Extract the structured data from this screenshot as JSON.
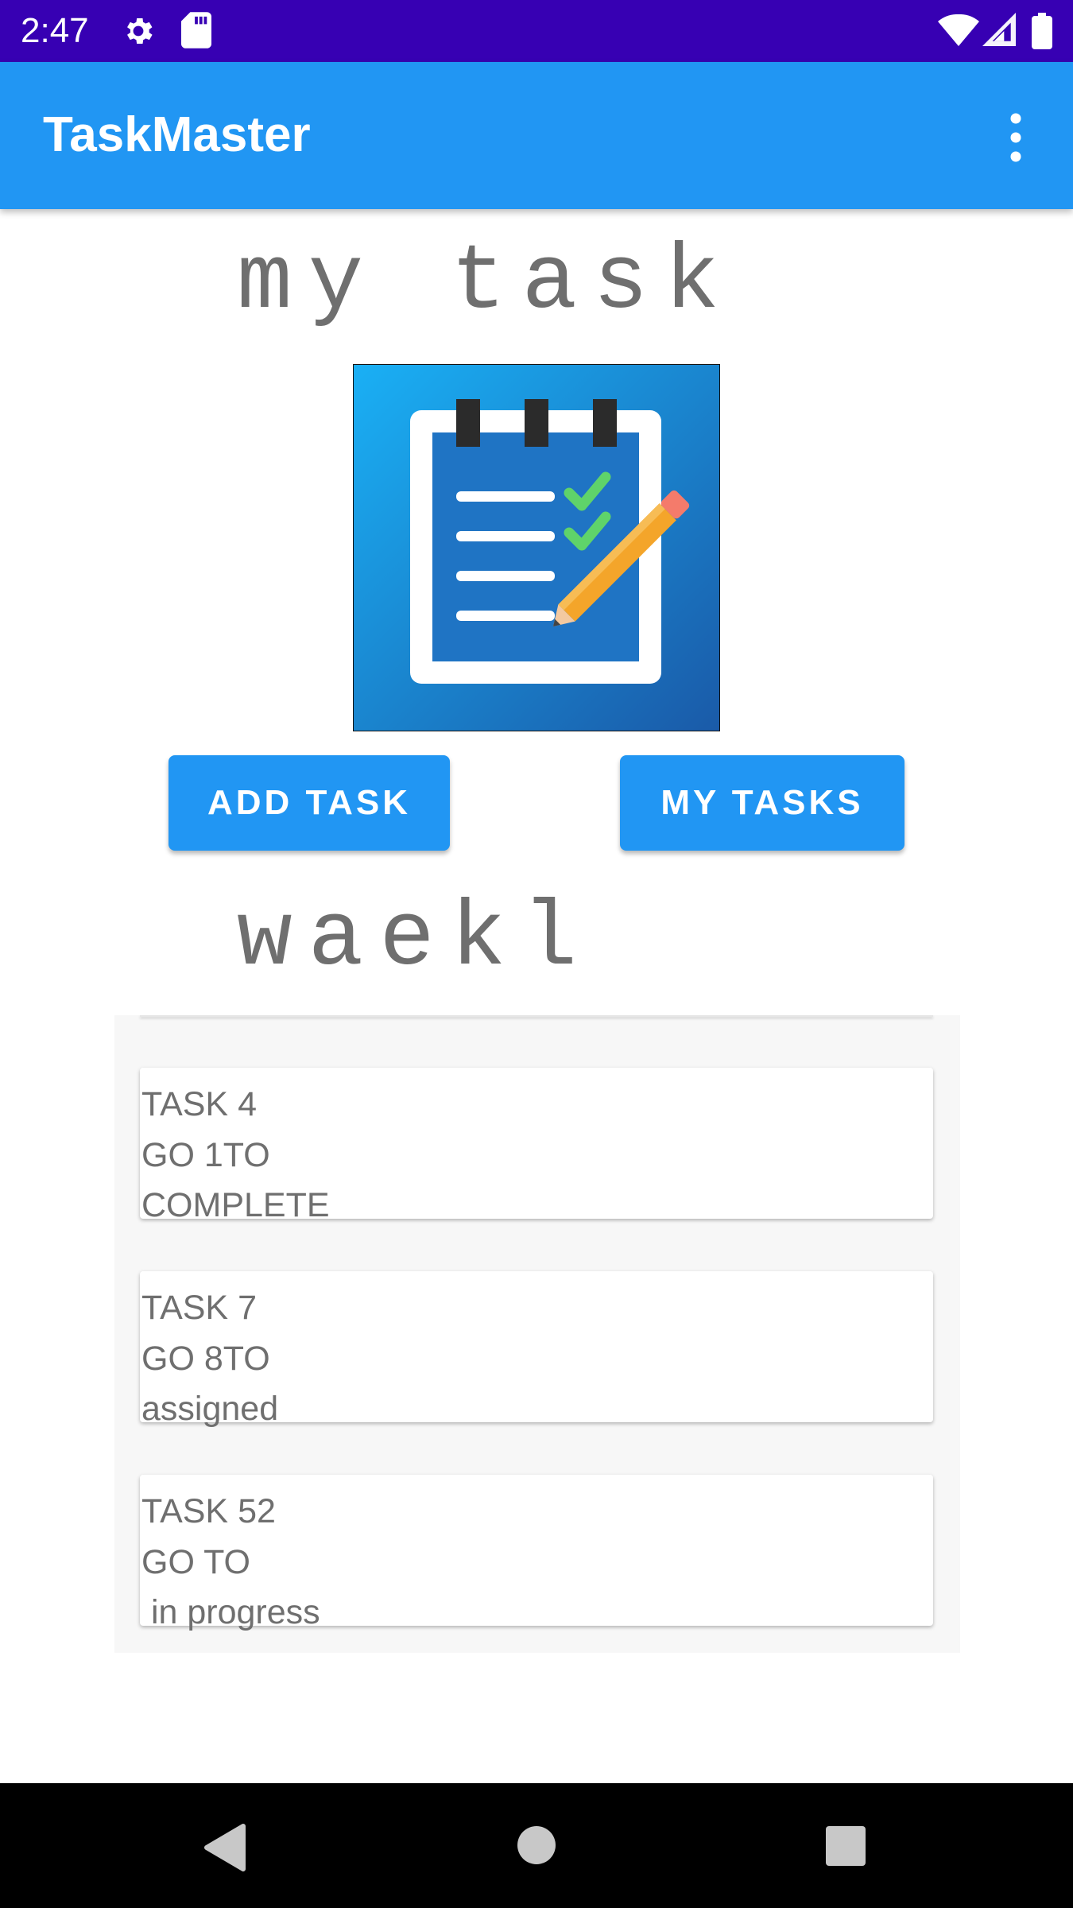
{
  "status_bar": {
    "time": "2:47",
    "icons": [
      "gear-icon",
      "sd-card-icon",
      "wifi-icon",
      "signal-icon",
      "battery-icon"
    ],
    "background": "#3700b3"
  },
  "app_bar": {
    "title": "TaskMaster",
    "background": "#2196f3",
    "menu_icon": "more-vert-icon"
  },
  "main": {
    "heading": "my task",
    "logo_icon": "notepad-checklist-pencil-icon",
    "buttons": {
      "add_task": "ADD TASK",
      "my_tasks": "MY TASKS"
    },
    "username": "waekl"
  },
  "tasks": [
    {
      "title": "TASK 4",
      "body": "GO 1TO",
      "state": "COMPLETE"
    },
    {
      "title": "TASK 7",
      "body": "GO 8TO",
      "state": "assigned"
    },
    {
      "title": "TASK 52",
      "body": "GO TO",
      "state": " in progress"
    }
  ],
  "nav_bar": {
    "icons": [
      "back-icon",
      "home-icon",
      "recents-icon"
    ]
  },
  "colors": {
    "accent": "#2196f3",
    "status_bar": "#3700b3",
    "text_gray": "#6f6f6f"
  }
}
